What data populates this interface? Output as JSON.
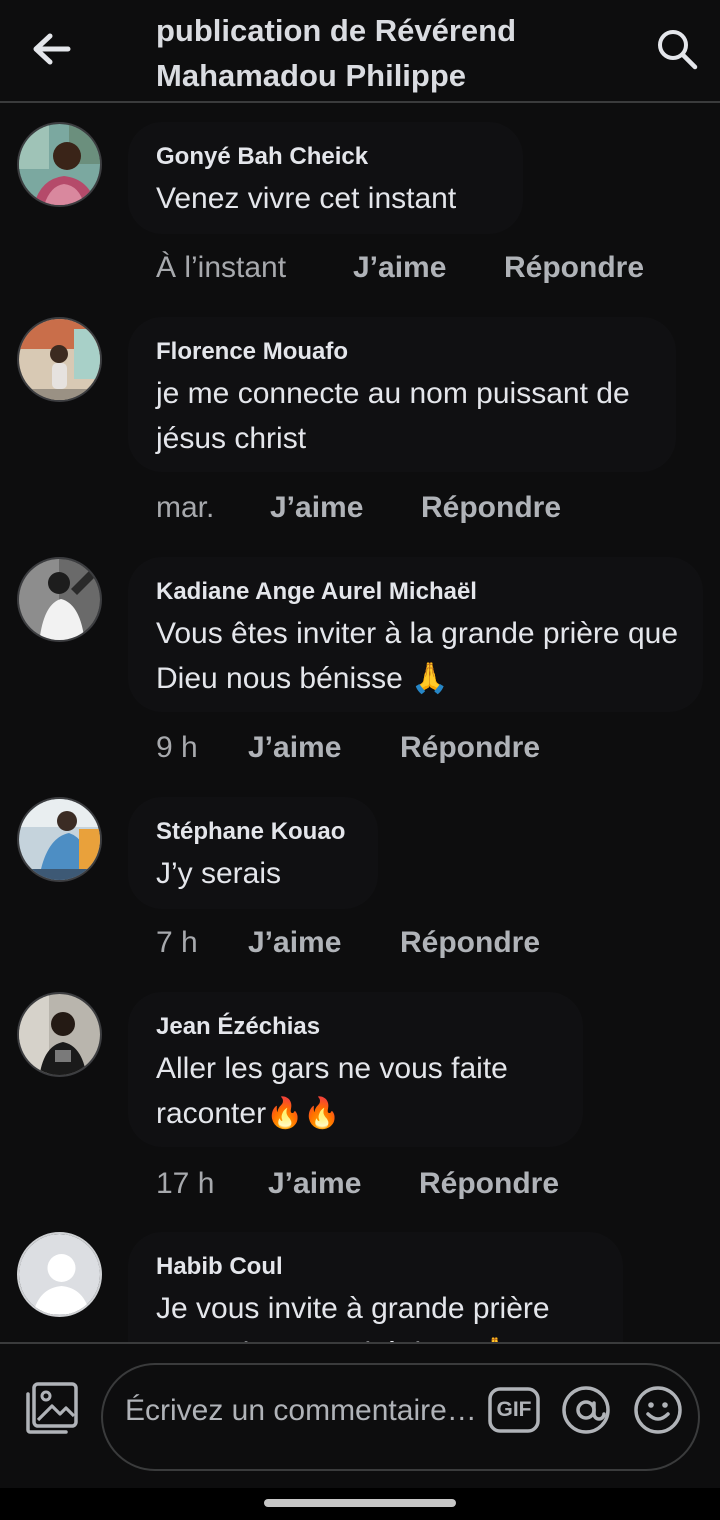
{
  "header": {
    "title": "publication de Révérend Mahamadou Philippe",
    "back_icon": "arrow-left-icon",
    "search_icon": "search-icon"
  },
  "comments": [
    {
      "author": "Gonyé Bah Cheick",
      "text": "Venez vivre cet instant",
      "time": "À l’instant",
      "like": "J’aime",
      "reply": "Répondre"
    },
    {
      "author": "Florence Mouafo",
      "text": "je me connecte au nom puissant de jésus christ",
      "time": "mar.",
      "like": "J’aime",
      "reply": "Répondre"
    },
    {
      "author": "Kadiane Ange Aurel Michaël",
      "text": "Vous êtes inviter à la grande prière que Dieu nous bénisse 🙏",
      "time": "9 h",
      "like": "J’aime",
      "reply": "Répondre"
    },
    {
      "author": "Stéphane Kouao",
      "text": "J’y serais",
      "time": "7 h",
      "like": "J’aime",
      "reply": "Répondre"
    },
    {
      "author": "Jean Ézéchias",
      "text": "Aller les gars ne vous faite raconter🔥🔥",
      "time": "17 h",
      "like": "J’aime",
      "reply": "Répondre"
    },
    {
      "author": "Habib Coul",
      "text": "Je vous invite à grande prière Que Dieu nous bénisse 🙏",
      "time": "",
      "like": "",
      "reply": ""
    }
  ],
  "composer": {
    "placeholder": "Écrivez un commentaire…",
    "gif_label": "GIF",
    "photo_icon": "photo-icon",
    "mention_icon": "at-sign-icon",
    "emoji_icon": "smiley-icon"
  },
  "colors": {
    "background": "#0d0d0e",
    "bubble": "#101012",
    "text": "#e4e6eb",
    "secondary": "#b0b3b8",
    "divider": "#3a3b3c"
  }
}
